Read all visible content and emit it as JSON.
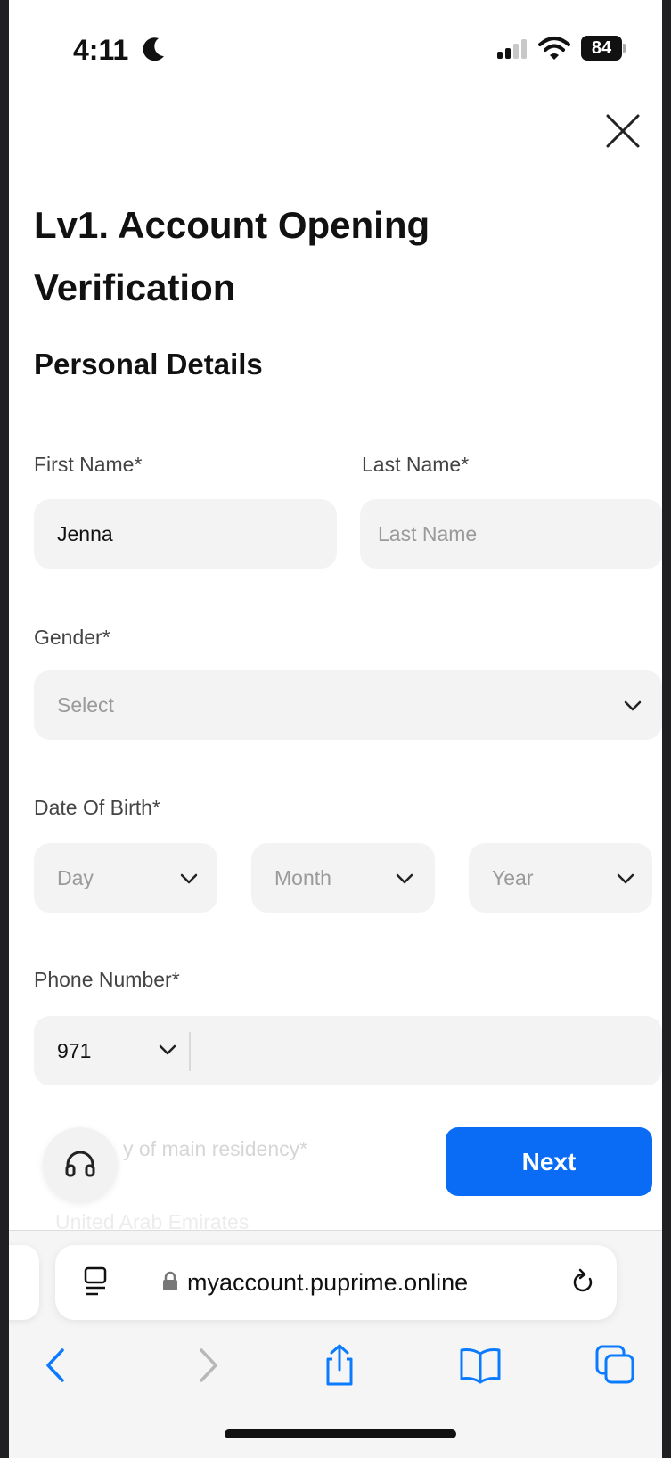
{
  "status_bar": {
    "time": "4:11",
    "battery": "84"
  },
  "title": "Lv1. Account Opening Verification",
  "section_title": "Personal Details",
  "form": {
    "first_name": {
      "label": "First Name*",
      "value": "Jenna"
    },
    "last_name": {
      "label": "Last Name*",
      "placeholder": "Last Name"
    },
    "gender": {
      "label": "Gender*",
      "placeholder": "Select"
    },
    "dob": {
      "label": "Date Of Birth*",
      "day": "Day",
      "month": "Month",
      "year": "Year"
    },
    "phone": {
      "label": "Phone Number*",
      "code": "971"
    },
    "residency": {
      "label": "Country of main residency*",
      "visible_label": "y of main residency*",
      "value": "United Arab Emirates"
    }
  },
  "next_label": "Next",
  "browser": {
    "url": "myaccount.puprime.online"
  },
  "colors": {
    "accent": "#0a6cf5",
    "field_bg": "#f3f3f3",
    "browser_accent": "#0a7aff"
  }
}
